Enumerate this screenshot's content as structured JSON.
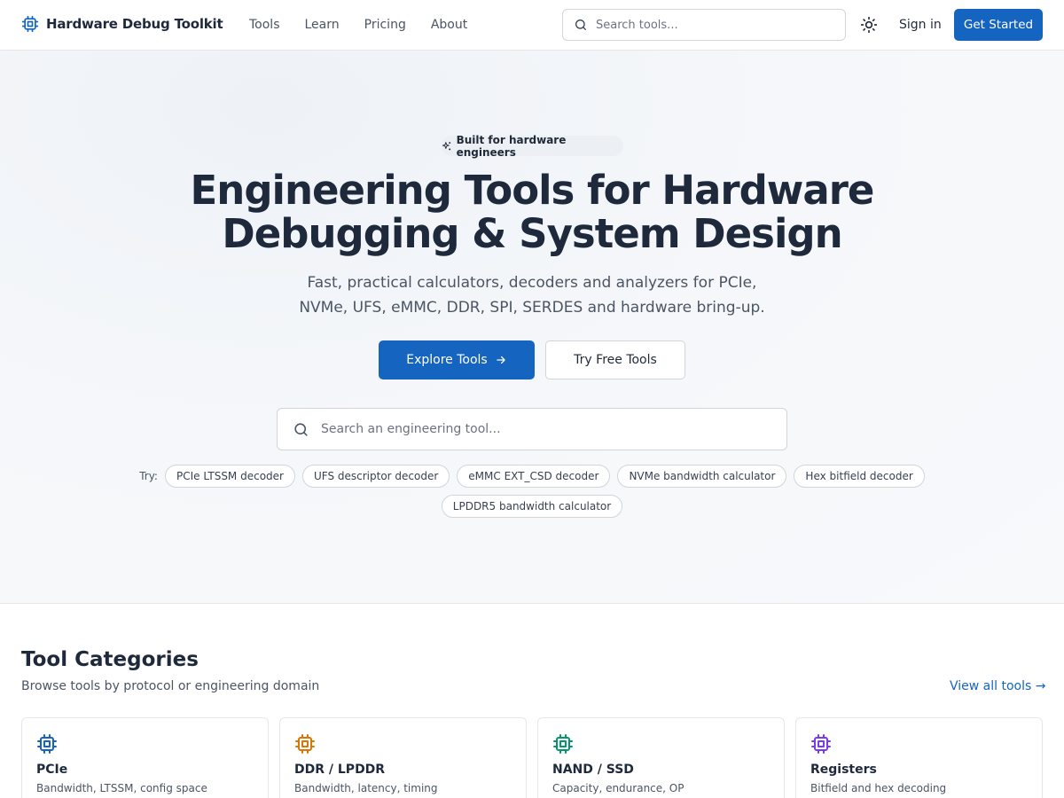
{
  "nav": {
    "brand": "Hardware Debug Toolkit",
    "links": [
      "Tools",
      "Learn",
      "Pricing",
      "About"
    ],
    "search_placeholder": "Search tools...",
    "theme_icon": "sun-icon",
    "sign_in": "Sign in",
    "get_started": "Get Started"
  },
  "hero": {
    "badge": "Built for hardware engineers",
    "title_line1": "Engineering Tools for Hardware",
    "title_line2": "Debugging & System Design",
    "subtitle_line1": "Fast, practical calculators, decoders and analyzers for PCIe,",
    "subtitle_line2": "NVMe, UFS, eMMC, DDR, SPI, SERDES and hardware bring-up.",
    "explore_button": "Explore Tools",
    "free_button": "Try Free Tools",
    "search_placeholder": "Search an engineering tool...",
    "try_label": "Try:",
    "suggestions": [
      "PCIe LTSSM decoder",
      "UFS descriptor decoder",
      "eMMC EXT_CSD decoder",
      "NVMe bandwidth calculator",
      "Hex bitfield decoder",
      "LPDDR5 bandwidth calculator"
    ]
  },
  "categories": {
    "title": "Tool Categories",
    "subtitle": "Browse tools by protocol or engineering domain",
    "view_all": "View all tools →",
    "items": [
      {
        "title": "PCIe",
        "desc": "Bandwidth, LTSSM, config space",
        "color": "#1565c0",
        "icon": "chip-icon"
      },
      {
        "title": "DDR / LPDDR",
        "desc": "Bandwidth, latency, timing",
        "color": "#d97706",
        "icon": "chip-icon"
      },
      {
        "title": "NAND / SSD",
        "desc": "Capacity, endurance, OP",
        "color": "#059669",
        "icon": "chip-icon"
      },
      {
        "title": "Registers",
        "desc": "Bitfield and hex decoding",
        "color": "#7c3aed",
        "icon": "chip-icon"
      }
    ]
  },
  "colors": {
    "accent": "#1565c0",
    "heading": "#1e293b",
    "muted": "#4b5563"
  }
}
